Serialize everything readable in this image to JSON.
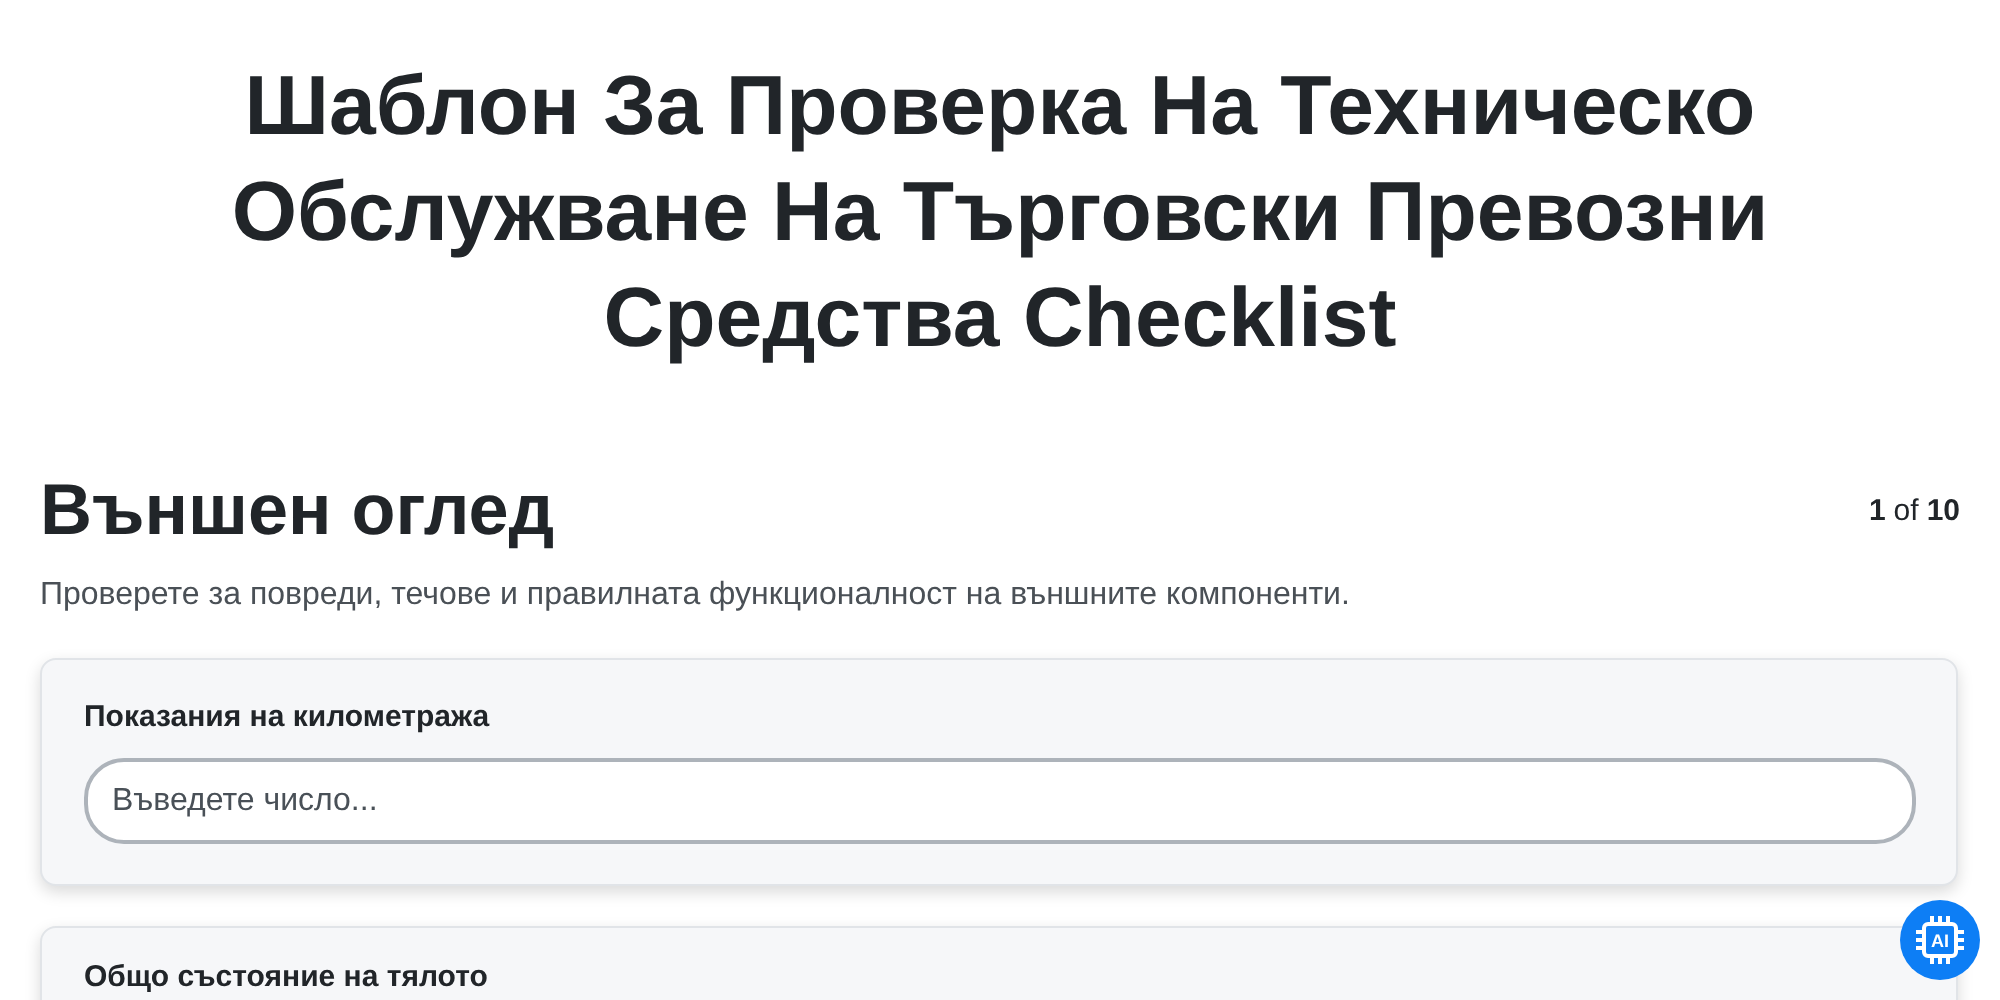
{
  "title": "Шаблон За Проверка На Техническо Обслужване На Търговски Превозни Средства Checklist",
  "section": {
    "heading": "Външен оглед",
    "progress_current": "1",
    "progress_of": "of",
    "progress_total": "10",
    "description": "Проверете за повреди, течове и правилната функционалност на външните компоненти."
  },
  "questions": [
    {
      "kind": "number",
      "label": "Показания на километража",
      "placeholder": "Въведете число..."
    },
    {
      "kind": "label_only",
      "label": "Общо състояние на тялото"
    }
  ],
  "ai_button": {
    "label": "AI"
  }
}
